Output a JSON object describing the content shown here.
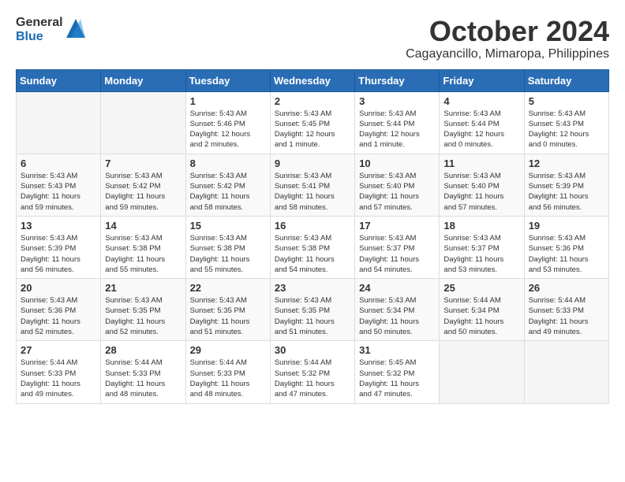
{
  "logo": {
    "general": "General",
    "blue": "Blue"
  },
  "title": "October 2024",
  "subtitle": "Cagayancillo, Mimaropa, Philippines",
  "days_of_week": [
    "Sunday",
    "Monday",
    "Tuesday",
    "Wednesday",
    "Thursday",
    "Friday",
    "Saturday"
  ],
  "weeks": [
    [
      {
        "day": "",
        "info": ""
      },
      {
        "day": "",
        "info": ""
      },
      {
        "day": "1",
        "info": "Sunrise: 5:43 AM\nSunset: 5:46 PM\nDaylight: 12 hours\nand 2 minutes."
      },
      {
        "day": "2",
        "info": "Sunrise: 5:43 AM\nSunset: 5:45 PM\nDaylight: 12 hours\nand 1 minute."
      },
      {
        "day": "3",
        "info": "Sunrise: 5:43 AM\nSunset: 5:44 PM\nDaylight: 12 hours\nand 1 minute."
      },
      {
        "day": "4",
        "info": "Sunrise: 5:43 AM\nSunset: 5:44 PM\nDaylight: 12 hours\nand 0 minutes."
      },
      {
        "day": "5",
        "info": "Sunrise: 5:43 AM\nSunset: 5:43 PM\nDaylight: 12 hours\nand 0 minutes."
      }
    ],
    [
      {
        "day": "6",
        "info": "Sunrise: 5:43 AM\nSunset: 5:43 PM\nDaylight: 11 hours\nand 59 minutes."
      },
      {
        "day": "7",
        "info": "Sunrise: 5:43 AM\nSunset: 5:42 PM\nDaylight: 11 hours\nand 59 minutes."
      },
      {
        "day": "8",
        "info": "Sunrise: 5:43 AM\nSunset: 5:42 PM\nDaylight: 11 hours\nand 58 minutes."
      },
      {
        "day": "9",
        "info": "Sunrise: 5:43 AM\nSunset: 5:41 PM\nDaylight: 11 hours\nand 58 minutes."
      },
      {
        "day": "10",
        "info": "Sunrise: 5:43 AM\nSunset: 5:40 PM\nDaylight: 11 hours\nand 57 minutes."
      },
      {
        "day": "11",
        "info": "Sunrise: 5:43 AM\nSunset: 5:40 PM\nDaylight: 11 hours\nand 57 minutes."
      },
      {
        "day": "12",
        "info": "Sunrise: 5:43 AM\nSunset: 5:39 PM\nDaylight: 11 hours\nand 56 minutes."
      }
    ],
    [
      {
        "day": "13",
        "info": "Sunrise: 5:43 AM\nSunset: 5:39 PM\nDaylight: 11 hours\nand 56 minutes."
      },
      {
        "day": "14",
        "info": "Sunrise: 5:43 AM\nSunset: 5:38 PM\nDaylight: 11 hours\nand 55 minutes."
      },
      {
        "day": "15",
        "info": "Sunrise: 5:43 AM\nSunset: 5:38 PM\nDaylight: 11 hours\nand 55 minutes."
      },
      {
        "day": "16",
        "info": "Sunrise: 5:43 AM\nSunset: 5:38 PM\nDaylight: 11 hours\nand 54 minutes."
      },
      {
        "day": "17",
        "info": "Sunrise: 5:43 AM\nSunset: 5:37 PM\nDaylight: 11 hours\nand 54 minutes."
      },
      {
        "day": "18",
        "info": "Sunrise: 5:43 AM\nSunset: 5:37 PM\nDaylight: 11 hours\nand 53 minutes."
      },
      {
        "day": "19",
        "info": "Sunrise: 5:43 AM\nSunset: 5:36 PM\nDaylight: 11 hours\nand 53 minutes."
      }
    ],
    [
      {
        "day": "20",
        "info": "Sunrise: 5:43 AM\nSunset: 5:36 PM\nDaylight: 11 hours\nand 52 minutes."
      },
      {
        "day": "21",
        "info": "Sunrise: 5:43 AM\nSunset: 5:35 PM\nDaylight: 11 hours\nand 52 minutes."
      },
      {
        "day": "22",
        "info": "Sunrise: 5:43 AM\nSunset: 5:35 PM\nDaylight: 11 hours\nand 51 minutes."
      },
      {
        "day": "23",
        "info": "Sunrise: 5:43 AM\nSunset: 5:35 PM\nDaylight: 11 hours\nand 51 minutes."
      },
      {
        "day": "24",
        "info": "Sunrise: 5:43 AM\nSunset: 5:34 PM\nDaylight: 11 hours\nand 50 minutes."
      },
      {
        "day": "25",
        "info": "Sunrise: 5:44 AM\nSunset: 5:34 PM\nDaylight: 11 hours\nand 50 minutes."
      },
      {
        "day": "26",
        "info": "Sunrise: 5:44 AM\nSunset: 5:33 PM\nDaylight: 11 hours\nand 49 minutes."
      }
    ],
    [
      {
        "day": "27",
        "info": "Sunrise: 5:44 AM\nSunset: 5:33 PM\nDaylight: 11 hours\nand 49 minutes."
      },
      {
        "day": "28",
        "info": "Sunrise: 5:44 AM\nSunset: 5:33 PM\nDaylight: 11 hours\nand 48 minutes."
      },
      {
        "day": "29",
        "info": "Sunrise: 5:44 AM\nSunset: 5:33 PM\nDaylight: 11 hours\nand 48 minutes."
      },
      {
        "day": "30",
        "info": "Sunrise: 5:44 AM\nSunset: 5:32 PM\nDaylight: 11 hours\nand 47 minutes."
      },
      {
        "day": "31",
        "info": "Sunrise: 5:45 AM\nSunset: 5:32 PM\nDaylight: 11 hours\nand 47 minutes."
      },
      {
        "day": "",
        "info": ""
      },
      {
        "day": "",
        "info": ""
      }
    ]
  ]
}
